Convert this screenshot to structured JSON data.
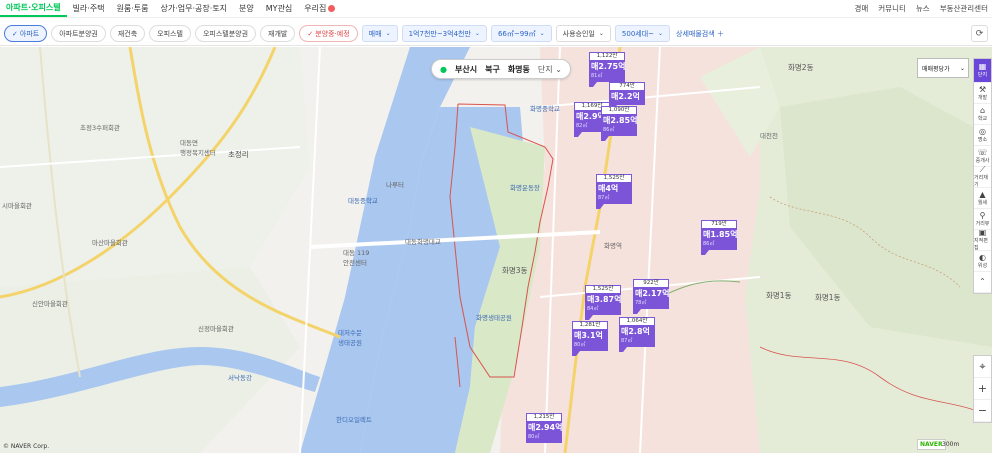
{
  "nav": {
    "tabs": [
      "아파트·오피스텔",
      "빌라·주택",
      "원룸·투룸",
      "상가·업무·공장·토지",
      "분양",
      "MY관심",
      "우리집"
    ],
    "right": [
      "경매",
      "커뮤니티",
      "뉴스",
      "부동산관리센터"
    ]
  },
  "filters": {
    "chips": [
      "아파트",
      "아파트분양권",
      "재건축",
      "오피스텔",
      "오피스텔분양권",
      "재개발",
      "분양중·예정"
    ],
    "selects": [
      "매매",
      "1억7천만~3억4천만",
      "66㎡~99㎡",
      "사용승인일",
      "500세대~"
    ],
    "detail": "상세매물검색"
  },
  "location": {
    "city": "부산시",
    "district": "북구",
    "dong": "화명동",
    "unit": "단지"
  },
  "price_select": "매매평당가",
  "tools": [
    {
      "label": "단지",
      "icon": "apartment-icon"
    },
    {
      "label": "개발",
      "icon": "crane-icon"
    },
    {
      "label": "학교",
      "icon": "school-icon"
    },
    {
      "label": "명소",
      "icon": "place-icon"
    },
    {
      "label": "중개사",
      "icon": "agent-icon"
    },
    {
      "label": "거리재기",
      "icon": "ruler-icon"
    },
    {
      "label": "월세",
      "icon": "rent-icon"
    },
    {
      "label": "거리뷰",
      "icon": "streetview-icon"
    },
    {
      "label": "지적편집",
      "icon": "cadastral-icon"
    },
    {
      "label": "위성",
      "icon": "satellite-icon"
    }
  ],
  "markers": [
    {
      "top": "1,122만",
      "price": "매2.75억",
      "area": "81㎡"
    },
    {
      "top": "774만",
      "price": "매2.2억",
      "area": ""
    },
    {
      "top": "1,169만",
      "price": "매2.9억",
      "area": "82㎡"
    },
    {
      "top": "1,090만",
      "price": "매2.85억",
      "area": "86㎡"
    },
    {
      "top": "1,525만",
      "price": "매4억",
      "area": "87㎡"
    },
    {
      "top": "719만",
      "price": "매1.85억",
      "area": "86㎡"
    },
    {
      "top": "1,525만",
      "price": "매3.87억",
      "area": "84㎡"
    },
    {
      "top": "922만",
      "price": "매2.17억",
      "area": "78㎡"
    },
    {
      "top": "1,281만",
      "price": "매3.1억",
      "area": "80㎡"
    },
    {
      "top": "1,064만",
      "price": "매2.8억",
      "area": "87㎡"
    },
    {
      "top": "1,215만",
      "price": "매2.94억",
      "area": "80㎡"
    }
  ],
  "labels": {
    "l1": "초정3수퍼회관",
    "l2": "대동면\n행정복지센터",
    "l3": "초정리",
    "l4": "나루터",
    "l5": "대동중학교",
    "l6": "시마을회관",
    "l7": "마산마을회관",
    "l8": "대동 119\n안전센터",
    "l9": "대동화명대교",
    "l10": "신안마을회관",
    "l11": "신정마을회관",
    "l12": "대저수문\n생태공원",
    "l13": "서낙동강",
    "l14": "화명생태공원",
    "l15": "화명1동",
    "l16": "화명2동",
    "l17": "화명역",
    "l18": "대천천",
    "l19": "화명운동장",
    "l20": "한디오일렉트",
    "l21": "화명중학교",
    "l22": "화명1동",
    "l23": "화명3동"
  },
  "scale": "300m",
  "copyright": "© NAVER Corp.",
  "brand": "NAVER"
}
